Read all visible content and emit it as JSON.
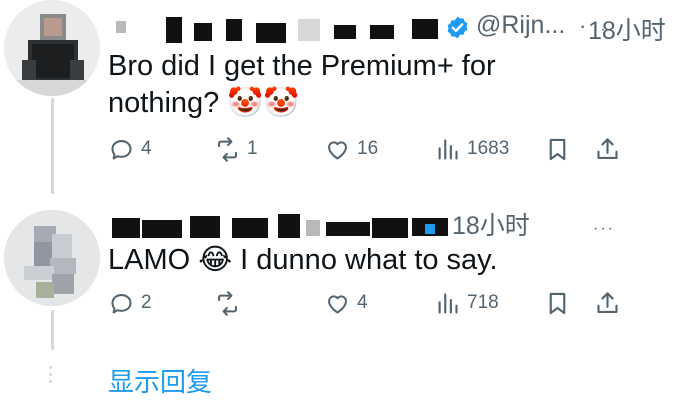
{
  "colors": {
    "accent": "#1d9bf0",
    "muted": "#536471",
    "text": "#0f1419",
    "verified": "#1d9bf0"
  },
  "tweets": [
    {
      "handle": "@Rijn...",
      "separator": "·",
      "time": "18小时",
      "more": "···",
      "text": "Bro did I get the Premium+ for\nnothing? 🤡🤡",
      "actions": {
        "replies": "4",
        "retweets": "1",
        "likes": "16",
        "views": "1683"
      }
    },
    {
      "time": "18小时",
      "more": "···",
      "text": "LAMO 😂 I dunno what to say.",
      "actions": {
        "replies": "2",
        "retweets": "",
        "likes": "4",
        "views": "718"
      }
    }
  ],
  "show_replies": "显示回复"
}
